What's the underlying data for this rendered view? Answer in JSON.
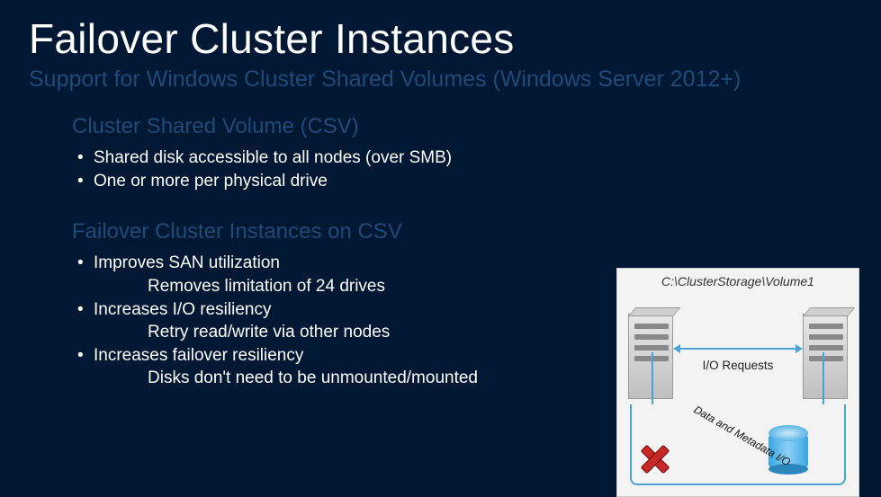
{
  "title": "Failover Cluster Instances",
  "subtitle": "Support for Windows Cluster Shared Volumes (Windows Server 2012+)",
  "section1": {
    "heading": "Cluster Shared Volume (CSV)",
    "items": [
      "Shared disk accessible to all nodes (over SMB)",
      "One or more per physical drive"
    ]
  },
  "section2": {
    "heading": "Failover Cluster Instances on CSV",
    "items": [
      {
        "text": "Improves SAN utilization",
        "sub": "Removes limitation of 24 drives"
      },
      {
        "text": "Increases I/O resiliency",
        "sub": "Retry read/write via other nodes"
      },
      {
        "text": "Increases failover resiliency",
        "sub": "Disks don't need to be unmounted/mounted"
      }
    ]
  },
  "diagram": {
    "path": "C:\\ClusterStorage\\Volume1",
    "io_label": "I/O   Requests",
    "meta_label": "Data and Metadata I/O"
  }
}
